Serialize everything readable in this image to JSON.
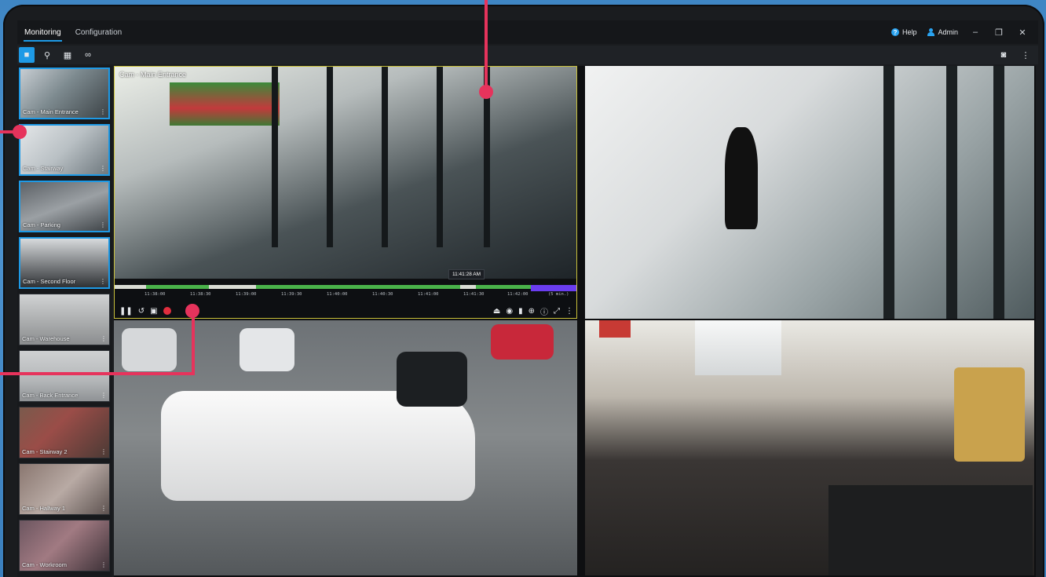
{
  "window": {
    "tabs": [
      {
        "label": "Monitoring",
        "active": true
      },
      {
        "label": "Configuration",
        "active": false
      }
    ],
    "help_label": "Help",
    "admin_label": "Admin",
    "minimize": "–",
    "restore": "❐",
    "close": "✕"
  },
  "toolbar": {
    "tools": [
      {
        "icon": "video-camera-icon",
        "glyph": "■",
        "active": true
      },
      {
        "icon": "search-icon",
        "glyph": "⚲",
        "active": false
      },
      {
        "icon": "grid-icon",
        "glyph": "▦",
        "active": false
      },
      {
        "icon": "link-icon",
        "glyph": "∞",
        "active": false
      }
    ],
    "right_tools": [
      {
        "icon": "snapshot-icon",
        "glyph": "◙"
      },
      {
        "icon": "more-vertical-icon",
        "glyph": "⋮"
      }
    ]
  },
  "cameras": [
    {
      "label": "Cam - Main Entrance",
      "selected": true
    },
    {
      "label": "Cam - Stairway",
      "selected": true
    },
    {
      "label": "Cam - Parking",
      "selected": true
    },
    {
      "label": "Cam - Second Floor",
      "selected": true
    },
    {
      "label": "Cam - Warehouse",
      "selected": false
    },
    {
      "label": "Cam - Back Entrance",
      "selected": false
    },
    {
      "label": "Cam - Stairway 2",
      "selected": false
    },
    {
      "label": "Cam - Hallway 1",
      "selected": false
    },
    {
      "label": "Cam - Workroom",
      "selected": false
    }
  ],
  "main_tile": {
    "title": "Cam - Main Entrance",
    "timeline": {
      "current_time": "11:41:28 AM",
      "ticks": [
        "11:38:00",
        "11:38:30",
        "11:39:00",
        "11:39:30",
        "11:40:00",
        "11:40:30",
        "11:41:00",
        "11:41:30",
        "11:42:00",
        "(5 min.)"
      ]
    }
  },
  "playback_controls": {
    "left": [
      {
        "icon": "pause-icon",
        "glyph": "❚❚"
      },
      {
        "icon": "rewind-icon",
        "glyph": "↺"
      },
      {
        "icon": "calendar-icon",
        "glyph": "▣"
      }
    ],
    "right": [
      {
        "icon": "export-icon",
        "glyph": "⏏"
      },
      {
        "icon": "camera-icon",
        "glyph": "◉"
      },
      {
        "icon": "bookmark-icon",
        "glyph": "▮"
      },
      {
        "icon": "zoom-icon",
        "glyph": "⊕"
      },
      {
        "icon": "info-icon",
        "glyph": "ⓘ"
      },
      {
        "icon": "fullscreen-icon",
        "glyph": "⤢"
      },
      {
        "icon": "more-vertical-icon",
        "glyph": "⋮"
      }
    ]
  },
  "colors": {
    "accent": "#1e9ae6",
    "callout": "#e6335c",
    "record": "#e02e3e"
  }
}
